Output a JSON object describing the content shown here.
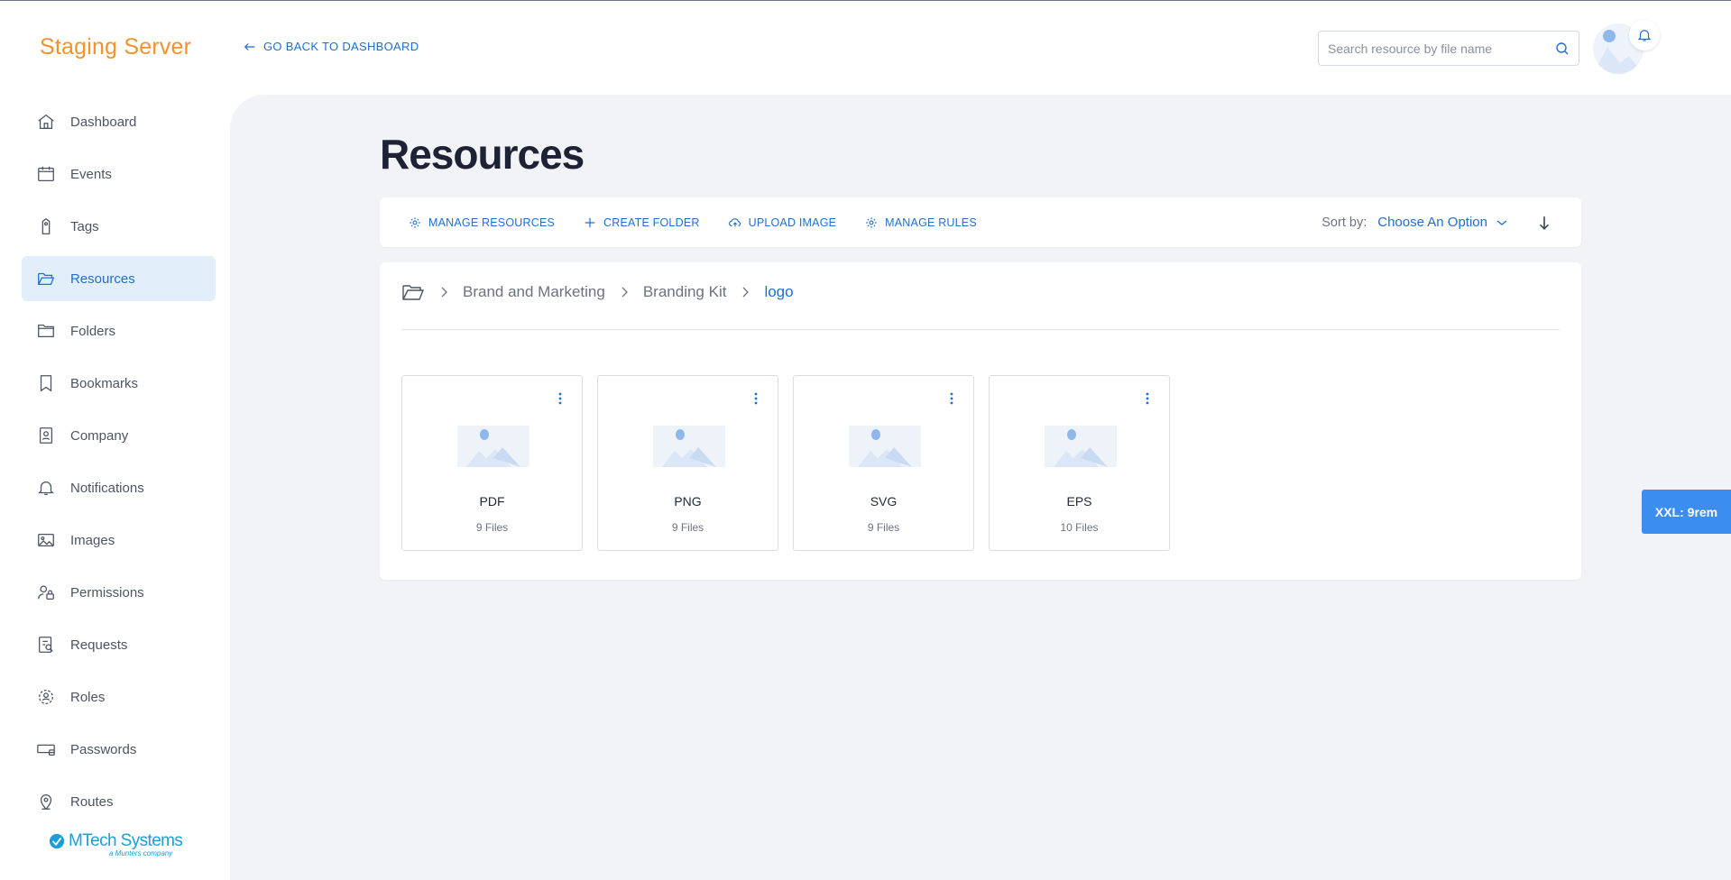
{
  "app": {
    "brand_title": "Staging Server",
    "back_link": "GO BACK TO DASHBOARD",
    "accent_color": "#1f6fd1",
    "brand_color": "#f2922b"
  },
  "search": {
    "placeholder": "Search resource by file name"
  },
  "sidebar": {
    "items": [
      {
        "label": "Dashboard",
        "icon": "home-icon"
      },
      {
        "label": "Events",
        "icon": "calendar-icon"
      },
      {
        "label": "Tags",
        "icon": "tag-icon"
      },
      {
        "label": "Resources",
        "icon": "folder-open-icon",
        "active": true
      },
      {
        "label": "Folders",
        "icon": "folder-icon"
      },
      {
        "label": "Bookmarks",
        "icon": "bookmark-icon"
      },
      {
        "label": "Company",
        "icon": "id-badge-icon"
      },
      {
        "label": "Notifications",
        "icon": "bell-icon"
      },
      {
        "label": "Images",
        "icon": "image-icon"
      },
      {
        "label": "Permissions",
        "icon": "user-lock-icon"
      },
      {
        "label": "Requests",
        "icon": "request-icon"
      },
      {
        "label": "Roles",
        "icon": "roles-icon"
      },
      {
        "label": "Passwords",
        "icon": "password-icon"
      },
      {
        "label": "Routes",
        "icon": "map-pin-icon"
      }
    ],
    "footer_logo": {
      "name": "MTech Systems",
      "tagline": "a Munters company"
    }
  },
  "main": {
    "title": "Resources",
    "toolbar": {
      "buttons": [
        {
          "label": "MANAGE RESOURCES",
          "icon": "gear-icon"
        },
        {
          "label": "CREATE FOLDER",
          "icon": "plus-icon"
        },
        {
          "label": "UPLOAD IMAGE",
          "icon": "cloud-upload-icon"
        },
        {
          "label": "MANAGE RULES",
          "icon": "gear-icon"
        }
      ],
      "sort_label": "Sort by:",
      "sort_value": "Choose An Option"
    },
    "breadcrumb": [
      "Brand and Marketing",
      "Branding Kit",
      "logo"
    ],
    "folders": [
      {
        "name": "PDF",
        "count": "9 Files"
      },
      {
        "name": "PNG",
        "count": "9 Files"
      },
      {
        "name": "SVG",
        "count": "9 Files"
      },
      {
        "name": "EPS",
        "count": "10 Files"
      }
    ]
  },
  "debug_badge": "XXL: 9rem"
}
